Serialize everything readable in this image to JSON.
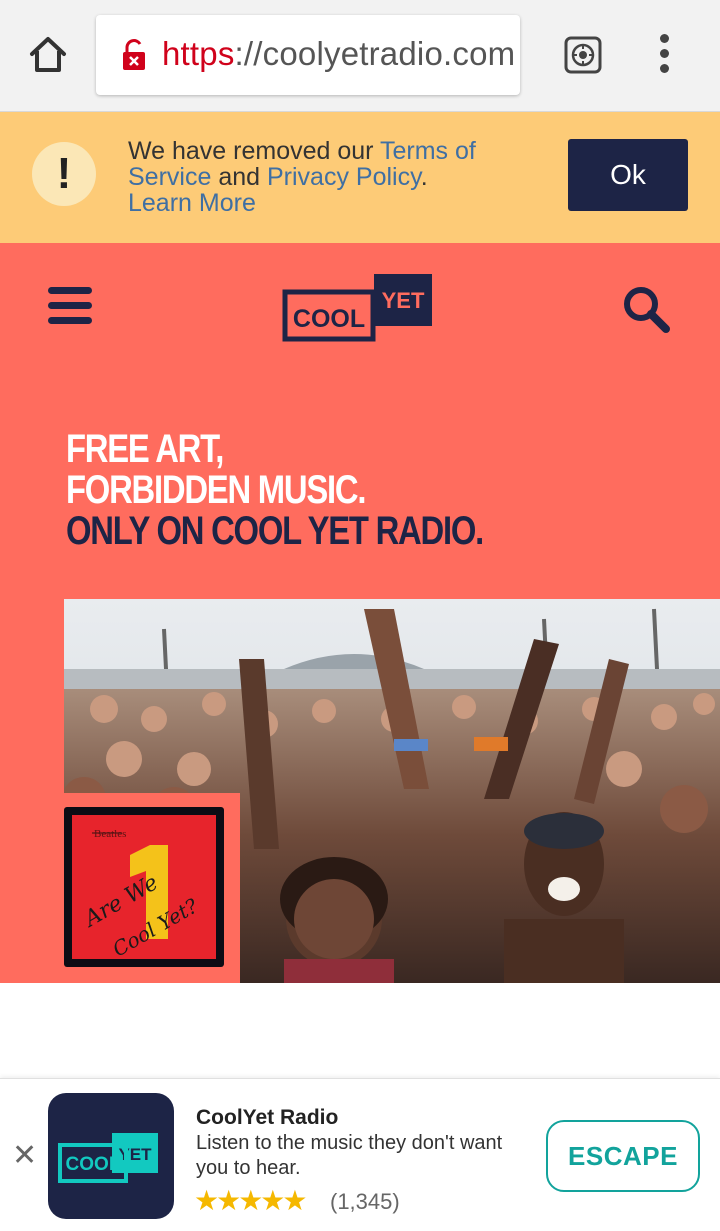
{
  "browser": {
    "url_scheme": "https",
    "url_separator": "://",
    "url_host": "coolyetradio.com",
    "icons": [
      "home-icon",
      "lock-open-icon",
      "shield-icon",
      "overflow-menu-icon"
    ]
  },
  "notice": {
    "icon": "!",
    "text_prefix": "We have removed our ",
    "terms_link": "Terms of Service",
    "text_middle": " and ",
    "privacy_link": "Privacy Policy",
    "text_suffix": ".",
    "learn_more": "Learn More",
    "ok_label": "Ok"
  },
  "header": {
    "logo_left": "COOL",
    "logo_right": "YET",
    "icons": [
      "menu-icon",
      "search-icon"
    ]
  },
  "hero": {
    "line1": "FREE ART,",
    "line2": "FORBIDDEN MUSIC.",
    "line3": "ONLY ON COOL YET RADIO.",
    "album_band": "Beatles",
    "album_number": "1",
    "album_text_1": "Are We",
    "album_text_2": "Cool Yet?"
  },
  "ad": {
    "close": "✕",
    "logo_left": "COOL",
    "logo_right": "YET",
    "title": "CoolYet Radio",
    "description": "Listen to the music they don't want you to hear.",
    "stars": "★★★★★",
    "rating": 5,
    "review_count": "(1,345)",
    "cta": "ESCAPE"
  },
  "colors": {
    "banner": "#fdcb77",
    "hero_bg": "#ff6c5e",
    "navy": "#1d2446",
    "accent_teal": "#12a39c",
    "link_blue": "#3f6fa3"
  }
}
